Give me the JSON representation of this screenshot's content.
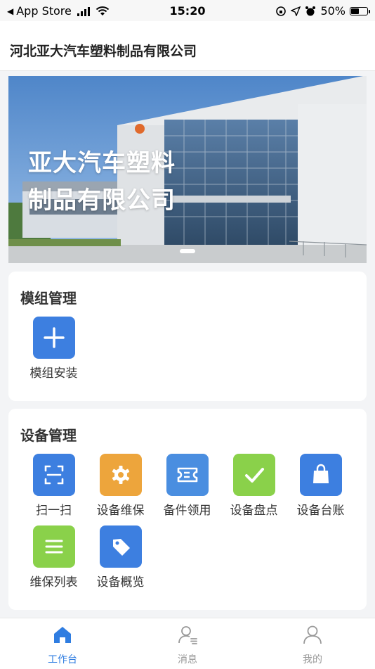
{
  "status_bar": {
    "back_label": "App Store",
    "time": "15:20",
    "battery_text": "50%",
    "battery_level": 0.5
  },
  "header": {
    "title": "河北亚大汽车塑料制品有限公司"
  },
  "banner": {
    "slogan_line1": "亚大汽车塑料",
    "slogan_line2": "制品有限公司"
  },
  "module_section": {
    "title": "模组管理",
    "items": [
      {
        "label": "模组安装",
        "icon": "plus-icon",
        "color": "#3d7fe0"
      }
    ]
  },
  "equipment_section": {
    "title": "设备管理",
    "items": [
      {
        "label": "扫一扫",
        "icon": "scan-icon",
        "color": "#3d7fe0"
      },
      {
        "label": "设备维保",
        "icon": "gear-icon",
        "color": "#eda53c"
      },
      {
        "label": "备件领用",
        "icon": "ticket-icon",
        "color": "#4a8ee0"
      },
      {
        "label": "设备盘点",
        "icon": "check-icon",
        "color": "#8ad14a"
      },
      {
        "label": "设备台账",
        "icon": "bag-icon",
        "color": "#3d7fe0"
      },
      {
        "label": "维保列表",
        "icon": "list-icon",
        "color": "#8ad14a"
      },
      {
        "label": "设备概览",
        "icon": "tag-icon",
        "color": "#3d7fe0"
      }
    ]
  },
  "tab_bar": {
    "items": [
      {
        "label": "工作台",
        "icon": "home-icon",
        "active": true
      },
      {
        "label": "消息",
        "icon": "message-user-icon",
        "active": false
      },
      {
        "label": "我的",
        "icon": "user-icon",
        "active": false
      }
    ],
    "active_color": "#2f7de1",
    "inactive_color": "#999999"
  }
}
